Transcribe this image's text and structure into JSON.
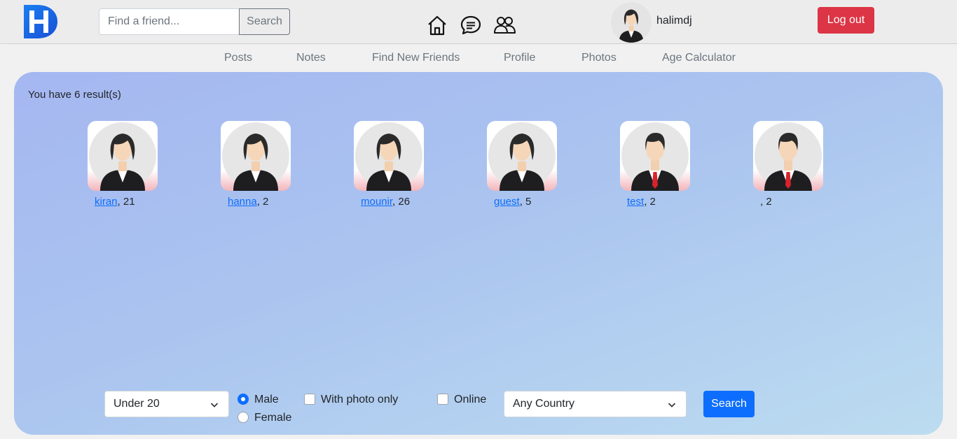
{
  "header": {
    "search_placeholder": "Find a friend...",
    "search_button": "Search",
    "icons": [
      "home-icon",
      "chat-icon",
      "friends-icon"
    ],
    "username": "halimdj",
    "logout_label": "Log out",
    "brand_colors": {
      "logo": "#1e6fe8",
      "logout": "#dc3545",
      "primary": "#0d6efd"
    }
  },
  "subnav": {
    "items": [
      "Posts",
      "Notes",
      "Find New Friends",
      "Profile",
      "Photos",
      "Age Calculator"
    ]
  },
  "results": {
    "count_text": "You have 6 result(s)",
    "people": [
      {
        "name": "kiran",
        "suffix": ", 21",
        "avatar": "female"
      },
      {
        "name": "hanna",
        "suffix": ", 2",
        "avatar": "female"
      },
      {
        "name": "mounir",
        "suffix": ", 26",
        "avatar": "female"
      },
      {
        "name": "guest",
        "suffix": ", 5",
        "avatar": "female"
      },
      {
        "name": "test",
        "suffix": ", 2",
        "avatar": "male"
      },
      {
        "name": "",
        "suffix": ", 2",
        "avatar": "male"
      }
    ]
  },
  "filters": {
    "age_select": "Under 20",
    "gender_options": [
      "Male",
      "Female"
    ],
    "gender_selected": "Male",
    "with_photo_label": "With photo only",
    "online_label": "Online",
    "country_select": "Any Country",
    "search_label": "Search"
  }
}
